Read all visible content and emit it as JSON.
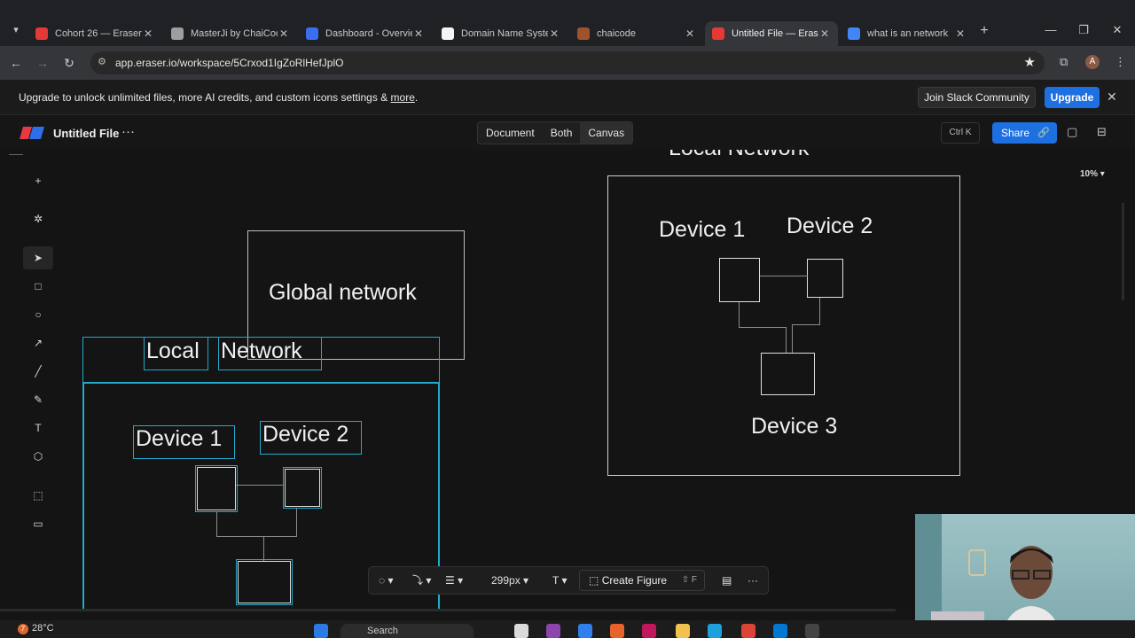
{
  "browser": {
    "tabs": [
      {
        "title": "Cohort 26 — Eraser",
        "color": "#e53935"
      },
      {
        "title": "MasterJi by ChaiCode",
        "color": "#9e9e9e"
      },
      {
        "title": "Dashboard - Overview",
        "color": "#3b6df0"
      },
      {
        "title": "Domain Name System",
        "color": "#f5f5f5"
      },
      {
        "title": "chaicode",
        "color": "#a0522d"
      },
      {
        "title": "Untitled File — Eraser",
        "color": "#e53935"
      },
      {
        "title": "what is an network",
        "color": "#4285f4"
      }
    ],
    "active_tab": 5,
    "url": "app.eraser.io/workspace/5Crxod1IgZoRlHefJplO",
    "new_tab": "+",
    "avatar": "A"
  },
  "banner": {
    "text": "Upgrade to unlock unlimited files, more AI credits, and custom icons settings & ",
    "link": "more",
    "suffix": ".",
    "slack": "Join Slack Community",
    "upgrade": "Upgrade"
  },
  "app": {
    "file_name": "Untitled File",
    "views": [
      "Document",
      "Both",
      "Canvas"
    ],
    "ctrl_k": "Ctrl K",
    "share": "Share",
    "zoom": "10%"
  },
  "canvas": {
    "top_partial_label": "Local Network",
    "global_label": "Global network",
    "local_word1": "Local",
    "local_word2": "Network",
    "left_device1": "Device 1",
    "left_device2": "Device 2",
    "right_device1": "Device 1",
    "right_device2": "Device 2",
    "right_device3": "Device 3"
  },
  "floatbar": {
    "size": "299px",
    "text_tool": "T",
    "create_figure": "Create Figure",
    "create_shortcut": "⇧ F"
  },
  "taskbar": {
    "temperature": "28°C",
    "search": "Search",
    "weather_badge": "7"
  }
}
